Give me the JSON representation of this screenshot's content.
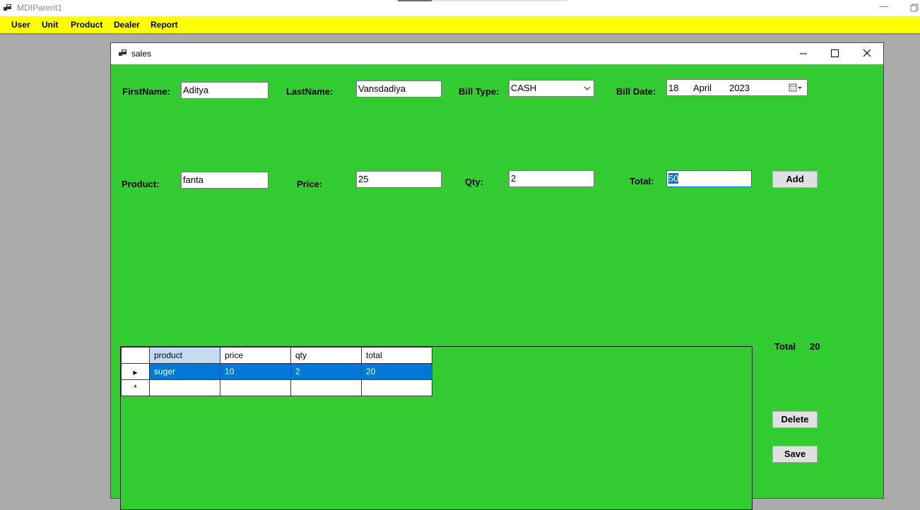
{
  "parent": {
    "title": "MDIParent1",
    "minimize_glyph": "—"
  },
  "menu": [
    "User",
    "Unit",
    "Product",
    "Dealer",
    "Report"
  ],
  "sales_window": {
    "title": "sales"
  },
  "form": {
    "firstname_label": "FirstName:",
    "firstname_value": "Aditya",
    "lastname_label": "LastName:",
    "lastname_value": "Vansdadiya",
    "billtype_label": "Bill Type:",
    "billtype_value": "CASH",
    "billdate_label": "Bill Date:",
    "billdate": {
      "day": "18",
      "month": "April",
      "year": "2023"
    },
    "product_label": "Product:",
    "product_value": "fanta",
    "price_label": "Price:",
    "price_value": "25",
    "qty_label": "Qty:",
    "qty_value": "2",
    "total_label": "Total:",
    "total_value": "50",
    "add_button": "Add"
  },
  "grid": {
    "columns": [
      "product",
      "price",
      "qty",
      "total"
    ],
    "rows": [
      {
        "product": "suger",
        "price": "10",
        "qty": "2",
        "total": "20"
      }
    ],
    "current_row_glyph": "▶",
    "new_row_glyph": "*"
  },
  "summary": {
    "total_label": "Total",
    "total_value": "20",
    "delete_button": "Delete",
    "save_button": "Save"
  },
  "colors": {
    "menu_bar": "#ffff00",
    "form_background": "#33cc33",
    "selection": "#0078d7"
  }
}
